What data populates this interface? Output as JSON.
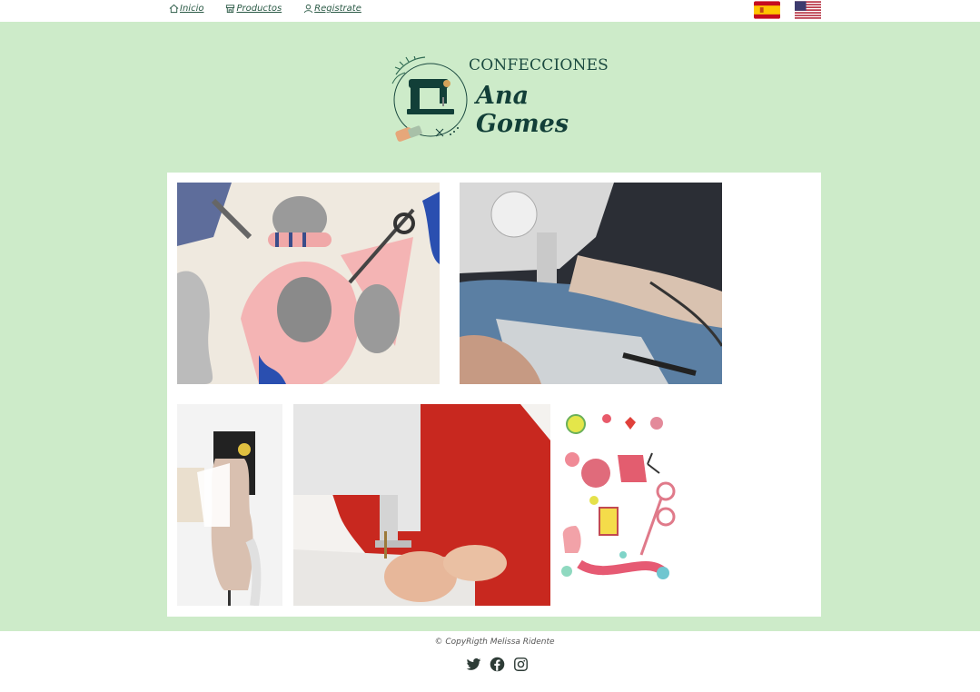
{
  "nav": {
    "items": [
      {
        "label": "Inicio",
        "icon": "home-icon"
      },
      {
        "label": "Productos",
        "icon": "store-icon"
      },
      {
        "label": "Registrate",
        "icon": "user-icon"
      }
    ]
  },
  "languages": [
    {
      "code": "es",
      "icon": "spain-flag-icon"
    },
    {
      "code": "en",
      "icon": "usa-flag-icon"
    }
  ],
  "logo": {
    "title": "CONFECCIONES",
    "script": "Ana Gomes"
  },
  "gallery": {
    "images": [
      {
        "name": "sewing-collage-photo"
      },
      {
        "name": "sewing-machine-jeans-photo"
      },
      {
        "name": "dress-form-photo"
      },
      {
        "name": "woman-sewing-photo"
      },
      {
        "name": "sewing-illustration"
      }
    ]
  },
  "footer": {
    "copyright": "© CopyRigth Melissa Ridente",
    "social": [
      "twitter-icon",
      "facebook-icon",
      "instagram-icon"
    ]
  },
  "colors": {
    "hero_bg": "#cdebc9",
    "accent": "#1b4a40"
  }
}
